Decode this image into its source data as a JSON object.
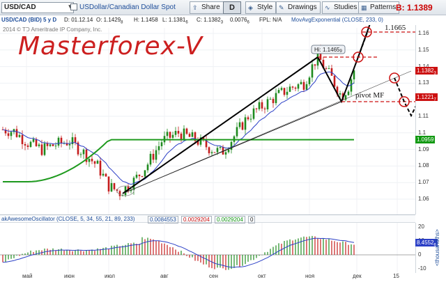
{
  "toolbar": {
    "symbol": "USD/CAD",
    "symbol_description": "USDollar/Canadian Dollar Spot",
    "share_label": "Share",
    "aggregation_label": "D",
    "style_label": "Style",
    "drawings_label": "Drawings",
    "studies_label": "Studies",
    "patterns_label": "Patterns",
    "bid_price": "B: 1.1389"
  },
  "quote": {
    "title": "USD/CAD (BID) 5 y D",
    "date": "D: 01.12.14",
    "open": "O: 1.1429",
    "open_sub": "8",
    "high": "H: 1.1458",
    "low": "L: 1.1381",
    "low_sub": "6",
    "close": "C: 1.1382",
    "close_sub": "3",
    "change": "0.0076",
    "change_sub": "6",
    "fpl": "FPL: N/A",
    "study": "MovAvgExponential (CLOSE, 233, 0)"
  },
  "copyright": "2014 © TD Ameritrade IP Company, Inc.",
  "watermark": "Masterforex-V",
  "annotations": {
    "high_bubble": "Hi: 1.1465",
    "high_bubble_sub": "9",
    "target_label": "1.1665",
    "pivot_label": "pivot MF"
  },
  "price_axis": {
    "ticks": [
      "1.16",
      "1.15",
      "1.14",
      "1.13",
      "1.12",
      "1.11",
      "1.1",
      "1.09",
      "1.08",
      "1.07",
      "1.06"
    ],
    "tag_last": "1.1382",
    "tag_last_sub": "3",
    "tag_ema": "1.1221",
    "tag_ema_sub": "7",
    "tag_ema2": "1.0959"
  },
  "oscillator": {
    "title": "akAwesomeOscillator (CLOSE, 5, 34, 55, 21, 89, 233)",
    "value1": "0.0084553",
    "value2": "0.0029204",
    "value3": "0.0029204",
    "value4": "0",
    "ticks": [
      "20",
      "10",
      "0",
      "-10"
    ],
    "tag": "8.4552",
    "tag_sub": "6",
    "units": "<thousandths>"
  },
  "x_axis": {
    "labels": [
      "май",
      "июн",
      "июл",
      "авг",
      "сен",
      "окт",
      "ноя",
      "дек",
      "15"
    ]
  },
  "colors": {
    "bull_candle": "#1e8a1e",
    "bear_candle": "#c41c1c",
    "ema_fast": "#2b3fc6",
    "ema_slow": "#1e9a1e",
    "tag_last": "#cc1111",
    "tag_ema": "#cc1111",
    "tag_ema2": "#119911",
    "oscillator_line": "#2b3fc6",
    "watermark": "#cc1f1f"
  },
  "icons": [
    "share-icon",
    "style-icon",
    "drawings-icon",
    "studies-icon",
    "patterns-icon"
  ]
}
